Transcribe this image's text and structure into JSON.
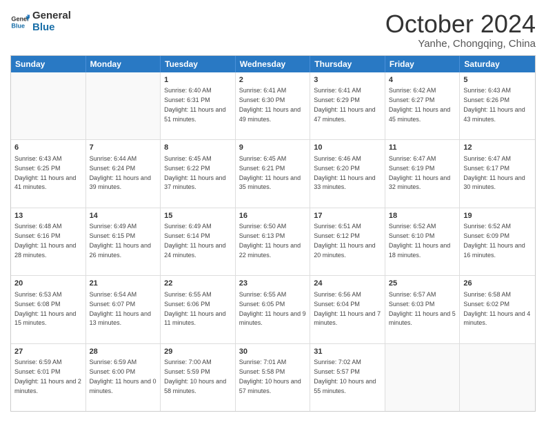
{
  "logo": {
    "line1": "General",
    "line2": "Blue"
  },
  "title": "October 2024",
  "location": "Yanhe, Chongqing, China",
  "days_of_week": [
    "Sunday",
    "Monday",
    "Tuesday",
    "Wednesday",
    "Thursday",
    "Friday",
    "Saturday"
  ],
  "weeks": [
    [
      {
        "day": "",
        "sunrise": "",
        "sunset": "",
        "daylight": ""
      },
      {
        "day": "",
        "sunrise": "",
        "sunset": "",
        "daylight": ""
      },
      {
        "day": "1",
        "sunrise": "Sunrise: 6:40 AM",
        "sunset": "Sunset: 6:31 PM",
        "daylight": "Daylight: 11 hours and 51 minutes."
      },
      {
        "day": "2",
        "sunrise": "Sunrise: 6:41 AM",
        "sunset": "Sunset: 6:30 PM",
        "daylight": "Daylight: 11 hours and 49 minutes."
      },
      {
        "day": "3",
        "sunrise": "Sunrise: 6:41 AM",
        "sunset": "Sunset: 6:29 PM",
        "daylight": "Daylight: 11 hours and 47 minutes."
      },
      {
        "day": "4",
        "sunrise": "Sunrise: 6:42 AM",
        "sunset": "Sunset: 6:27 PM",
        "daylight": "Daylight: 11 hours and 45 minutes."
      },
      {
        "day": "5",
        "sunrise": "Sunrise: 6:43 AM",
        "sunset": "Sunset: 6:26 PM",
        "daylight": "Daylight: 11 hours and 43 minutes."
      }
    ],
    [
      {
        "day": "6",
        "sunrise": "Sunrise: 6:43 AM",
        "sunset": "Sunset: 6:25 PM",
        "daylight": "Daylight: 11 hours and 41 minutes."
      },
      {
        "day": "7",
        "sunrise": "Sunrise: 6:44 AM",
        "sunset": "Sunset: 6:24 PM",
        "daylight": "Daylight: 11 hours and 39 minutes."
      },
      {
        "day": "8",
        "sunrise": "Sunrise: 6:45 AM",
        "sunset": "Sunset: 6:22 PM",
        "daylight": "Daylight: 11 hours and 37 minutes."
      },
      {
        "day": "9",
        "sunrise": "Sunrise: 6:45 AM",
        "sunset": "Sunset: 6:21 PM",
        "daylight": "Daylight: 11 hours and 35 minutes."
      },
      {
        "day": "10",
        "sunrise": "Sunrise: 6:46 AM",
        "sunset": "Sunset: 6:20 PM",
        "daylight": "Daylight: 11 hours and 33 minutes."
      },
      {
        "day": "11",
        "sunrise": "Sunrise: 6:47 AM",
        "sunset": "Sunset: 6:19 PM",
        "daylight": "Daylight: 11 hours and 32 minutes."
      },
      {
        "day": "12",
        "sunrise": "Sunrise: 6:47 AM",
        "sunset": "Sunset: 6:17 PM",
        "daylight": "Daylight: 11 hours and 30 minutes."
      }
    ],
    [
      {
        "day": "13",
        "sunrise": "Sunrise: 6:48 AM",
        "sunset": "Sunset: 6:16 PM",
        "daylight": "Daylight: 11 hours and 28 minutes."
      },
      {
        "day": "14",
        "sunrise": "Sunrise: 6:49 AM",
        "sunset": "Sunset: 6:15 PM",
        "daylight": "Daylight: 11 hours and 26 minutes."
      },
      {
        "day": "15",
        "sunrise": "Sunrise: 6:49 AM",
        "sunset": "Sunset: 6:14 PM",
        "daylight": "Daylight: 11 hours and 24 minutes."
      },
      {
        "day": "16",
        "sunrise": "Sunrise: 6:50 AM",
        "sunset": "Sunset: 6:13 PM",
        "daylight": "Daylight: 11 hours and 22 minutes."
      },
      {
        "day": "17",
        "sunrise": "Sunrise: 6:51 AM",
        "sunset": "Sunset: 6:12 PM",
        "daylight": "Daylight: 11 hours and 20 minutes."
      },
      {
        "day": "18",
        "sunrise": "Sunrise: 6:52 AM",
        "sunset": "Sunset: 6:10 PM",
        "daylight": "Daylight: 11 hours and 18 minutes."
      },
      {
        "day": "19",
        "sunrise": "Sunrise: 6:52 AM",
        "sunset": "Sunset: 6:09 PM",
        "daylight": "Daylight: 11 hours and 16 minutes."
      }
    ],
    [
      {
        "day": "20",
        "sunrise": "Sunrise: 6:53 AM",
        "sunset": "Sunset: 6:08 PM",
        "daylight": "Daylight: 11 hours and 15 minutes."
      },
      {
        "day": "21",
        "sunrise": "Sunrise: 6:54 AM",
        "sunset": "Sunset: 6:07 PM",
        "daylight": "Daylight: 11 hours and 13 minutes."
      },
      {
        "day": "22",
        "sunrise": "Sunrise: 6:55 AM",
        "sunset": "Sunset: 6:06 PM",
        "daylight": "Daylight: 11 hours and 11 minutes."
      },
      {
        "day": "23",
        "sunrise": "Sunrise: 6:55 AM",
        "sunset": "Sunset: 6:05 PM",
        "daylight": "Daylight: 11 hours and 9 minutes."
      },
      {
        "day": "24",
        "sunrise": "Sunrise: 6:56 AM",
        "sunset": "Sunset: 6:04 PM",
        "daylight": "Daylight: 11 hours and 7 minutes."
      },
      {
        "day": "25",
        "sunrise": "Sunrise: 6:57 AM",
        "sunset": "Sunset: 6:03 PM",
        "daylight": "Daylight: 11 hours and 5 minutes."
      },
      {
        "day": "26",
        "sunrise": "Sunrise: 6:58 AM",
        "sunset": "Sunset: 6:02 PM",
        "daylight": "Daylight: 11 hours and 4 minutes."
      }
    ],
    [
      {
        "day": "27",
        "sunrise": "Sunrise: 6:59 AM",
        "sunset": "Sunset: 6:01 PM",
        "daylight": "Daylight: 11 hours and 2 minutes."
      },
      {
        "day": "28",
        "sunrise": "Sunrise: 6:59 AM",
        "sunset": "Sunset: 6:00 PM",
        "daylight": "Daylight: 11 hours and 0 minutes."
      },
      {
        "day": "29",
        "sunrise": "Sunrise: 7:00 AM",
        "sunset": "Sunset: 5:59 PM",
        "daylight": "Daylight: 10 hours and 58 minutes."
      },
      {
        "day": "30",
        "sunrise": "Sunrise: 7:01 AM",
        "sunset": "Sunset: 5:58 PM",
        "daylight": "Daylight: 10 hours and 57 minutes."
      },
      {
        "day": "31",
        "sunrise": "Sunrise: 7:02 AM",
        "sunset": "Sunset: 5:57 PM",
        "daylight": "Daylight: 10 hours and 55 minutes."
      },
      {
        "day": "",
        "sunrise": "",
        "sunset": "",
        "daylight": ""
      },
      {
        "day": "",
        "sunrise": "",
        "sunset": "",
        "daylight": ""
      }
    ]
  ]
}
